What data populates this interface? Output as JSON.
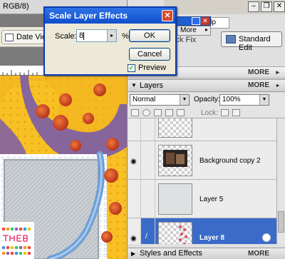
{
  "document": {
    "title": "RGB/8)"
  },
  "toolbar": {
    "date_view_label": "Date View",
    "quick_fix_label": "ick Fix",
    "standard_edit_label": "Standard Edit"
  },
  "window": {
    "help_text": "help",
    "more_menu_label": "More"
  },
  "panels": {
    "more_label_1": "MORE",
    "more_label_2": "MORE",
    "layers_title": "Layers",
    "layers_more": "MORE",
    "styles_title": "Styles and Effects",
    "styles_more": "MORE"
  },
  "layers_panel": {
    "blend_mode": "Normal",
    "opacity_label": "Opacity:",
    "opacity_value": "100%",
    "lock_label": "Lock:",
    "layers": [
      {
        "name": "",
        "visible": true,
        "selected": false
      },
      {
        "name": "Background copy 2",
        "visible": true,
        "selected": false
      },
      {
        "name": "Layer 5",
        "visible": false,
        "selected": false
      },
      {
        "name": "Layer 8",
        "visible": true,
        "selected": true
      }
    ]
  },
  "dialog": {
    "title": "Scale Layer Effects",
    "scale_label": "Scale:",
    "scale_value": "8",
    "percent_label": "%",
    "ok_label": "OK",
    "cancel_label": "Cancel",
    "preview_label": "Preview",
    "preview_checked": true
  },
  "colors": {
    "selection": "#3a6bc9",
    "dialog_title": "#0f4fcd",
    "canvas_yellow": "#f7c125",
    "canvas_purple": "#7a5ca8"
  }
}
